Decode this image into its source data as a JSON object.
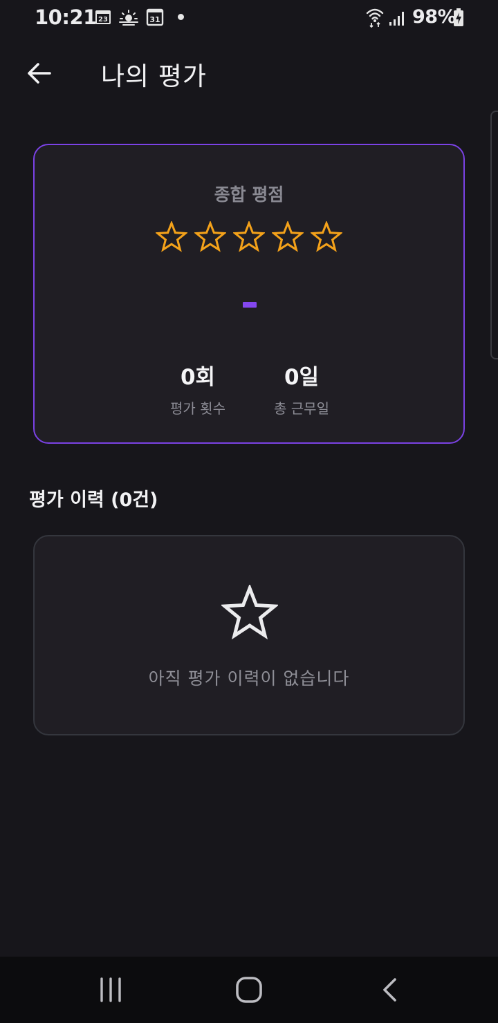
{
  "status_bar": {
    "time": "10:21",
    "calendar_day": "23",
    "date_day": "31",
    "battery": "98%",
    "icons": [
      "calendar-icon",
      "weather-icon",
      "calendar-date-icon",
      "notification-dot-icon",
      "wifi-icon",
      "signal-icon",
      "battery-charging-icon"
    ]
  },
  "app_bar": {
    "title": "나의 평가",
    "back_icon": "arrow-left-icon"
  },
  "summary": {
    "label": "종합 평점",
    "rating_filled": 0,
    "rating_max": 5,
    "star_color": "#f4a21a",
    "accent_color": "#7b42e6",
    "stats": [
      {
        "value": "0회",
        "label": "평가 횟수"
      },
      {
        "value": "0일",
        "label": "총 근무일"
      }
    ]
  },
  "history": {
    "title": "평가 이력 (0건)",
    "empty_icon": "star-outline-icon",
    "empty_text": "아직 평가 이력이 없습니다"
  },
  "nav_bar": {
    "icons": [
      "recent-apps-icon",
      "home-icon",
      "back-icon"
    ]
  }
}
